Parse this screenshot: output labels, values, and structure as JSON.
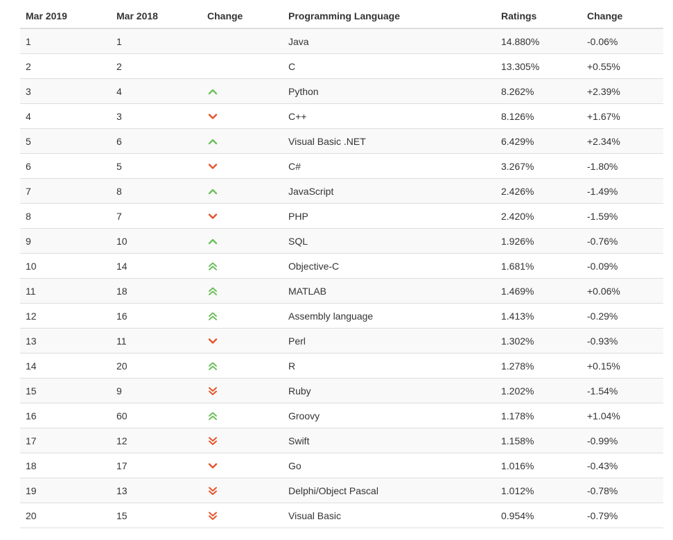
{
  "colors": {
    "up": "#6cbf5c",
    "down": "#e2542b",
    "stripe": "#f9f9f9",
    "border": "#dddddd"
  },
  "headers": {
    "mar2019": "Mar 2019",
    "mar2018": "Mar 2018",
    "change_icon": "Change",
    "language": "Programming Language",
    "ratings": "Ratings",
    "change": "Change"
  },
  "rows": [
    {
      "mar2019": "1",
      "mar2018": "1",
      "trend": "none",
      "language": "Java",
      "ratings": "14.880%",
      "change": "-0.06%"
    },
    {
      "mar2019": "2",
      "mar2018": "2",
      "trend": "none",
      "language": "C",
      "ratings": "13.305%",
      "change": "+0.55%"
    },
    {
      "mar2019": "3",
      "mar2018": "4",
      "trend": "up",
      "language": "Python",
      "ratings": "8.262%",
      "change": "+2.39%"
    },
    {
      "mar2019": "4",
      "mar2018": "3",
      "trend": "down",
      "language": "C++",
      "ratings": "8.126%",
      "change": "+1.67%"
    },
    {
      "mar2019": "5",
      "mar2018": "6",
      "trend": "up",
      "language": "Visual Basic .NET",
      "ratings": "6.429%",
      "change": "+2.34%"
    },
    {
      "mar2019": "6",
      "mar2018": "5",
      "trend": "down",
      "language": "C#",
      "ratings": "3.267%",
      "change": "-1.80%"
    },
    {
      "mar2019": "7",
      "mar2018": "8",
      "trend": "up",
      "language": "JavaScript",
      "ratings": "2.426%",
      "change": "-1.49%"
    },
    {
      "mar2019": "8",
      "mar2018": "7",
      "trend": "down",
      "language": "PHP",
      "ratings": "2.420%",
      "change": "-1.59%"
    },
    {
      "mar2019": "9",
      "mar2018": "10",
      "trend": "up",
      "language": "SQL",
      "ratings": "1.926%",
      "change": "-0.76%"
    },
    {
      "mar2019": "10",
      "mar2018": "14",
      "trend": "double-up",
      "language": "Objective-C",
      "ratings": "1.681%",
      "change": "-0.09%"
    },
    {
      "mar2019": "11",
      "mar2018": "18",
      "trend": "double-up",
      "language": "MATLAB",
      "ratings": "1.469%",
      "change": "+0.06%"
    },
    {
      "mar2019": "12",
      "mar2018": "16",
      "trend": "double-up",
      "language": "Assembly language",
      "ratings": "1.413%",
      "change": "-0.29%"
    },
    {
      "mar2019": "13",
      "mar2018": "11",
      "trend": "down",
      "language": "Perl",
      "ratings": "1.302%",
      "change": "-0.93%"
    },
    {
      "mar2019": "14",
      "mar2018": "20",
      "trend": "double-up",
      "language": "R",
      "ratings": "1.278%",
      "change": "+0.15%"
    },
    {
      "mar2019": "15",
      "mar2018": "9",
      "trend": "double-down",
      "language": "Ruby",
      "ratings": "1.202%",
      "change": "-1.54%"
    },
    {
      "mar2019": "16",
      "mar2018": "60",
      "trend": "double-up",
      "language": "Groovy",
      "ratings": "1.178%",
      "change": "+1.04%"
    },
    {
      "mar2019": "17",
      "mar2018": "12",
      "trend": "double-down",
      "language": "Swift",
      "ratings": "1.158%",
      "change": "-0.99%"
    },
    {
      "mar2019": "18",
      "mar2018": "17",
      "trend": "down",
      "language": "Go",
      "ratings": "1.016%",
      "change": "-0.43%"
    },
    {
      "mar2019": "19",
      "mar2018": "13",
      "trend": "double-down",
      "language": "Delphi/Object Pascal",
      "ratings": "1.012%",
      "change": "-0.78%"
    },
    {
      "mar2019": "20",
      "mar2018": "15",
      "trend": "double-down",
      "language": "Visual Basic",
      "ratings": "0.954%",
      "change": "-0.79%"
    }
  ]
}
